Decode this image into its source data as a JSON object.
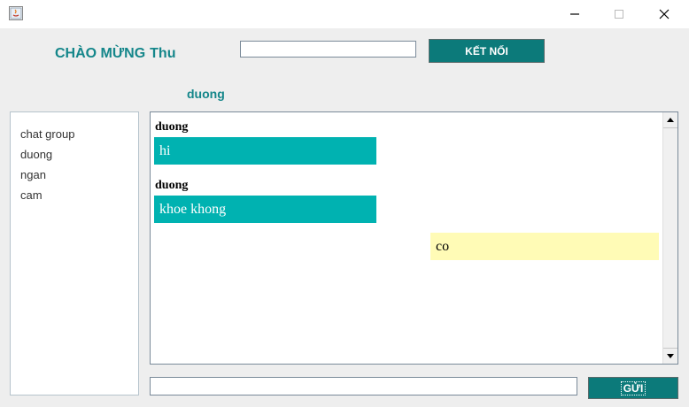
{
  "window": {
    "icons": {
      "app": "java-app-icon",
      "minimize": "minimize-icon",
      "maximize": "maximize-icon",
      "close": "close-icon"
    }
  },
  "header": {
    "welcome_label": "CHÀO MỪNG",
    "username": "Thu",
    "connect_input_value": "",
    "connect_button": "KẾT NỐI"
  },
  "chat": {
    "target": "duong",
    "messages": [
      {
        "sender": "duong",
        "text": "hi",
        "mine": false
      },
      {
        "sender": "duong",
        "text": "khoe khong",
        "mine": false
      },
      {
        "sender": "",
        "text": "co",
        "mine": true
      }
    ]
  },
  "contacts": [
    "chat group",
    "duong",
    "ngan",
    "cam"
  ],
  "composer": {
    "input_value": "",
    "send_button": "GỬI"
  },
  "colors": {
    "accent": "#0c7a7a",
    "title_text": "#14868a",
    "bubble_other": "#00b2b1",
    "bubble_mine": "#fffbb6"
  }
}
